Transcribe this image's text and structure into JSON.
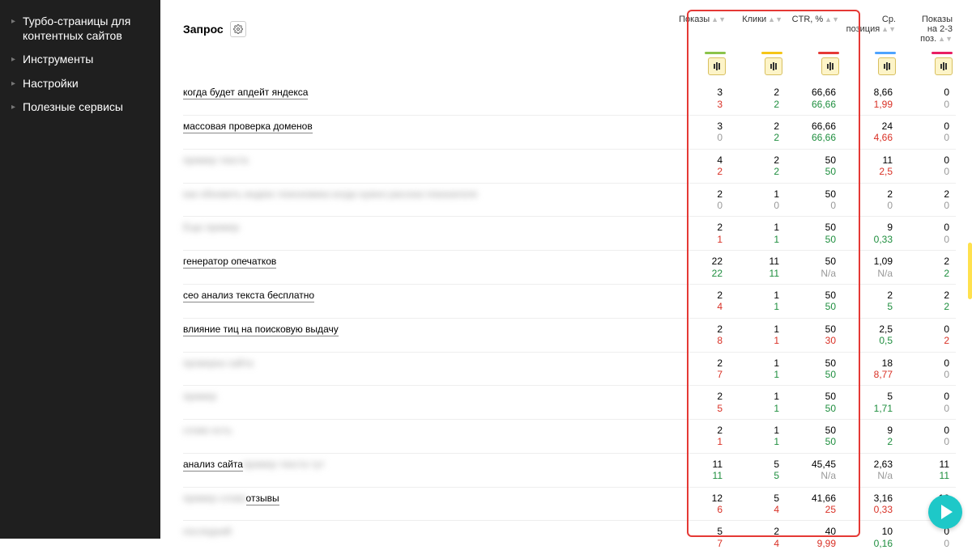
{
  "sidebar": {
    "items": [
      {
        "label": "Турбо-страницы для контентных сайтов"
      },
      {
        "label": "Инструменты"
      },
      {
        "label": "Настройки"
      },
      {
        "label": "Полезные сервисы"
      }
    ]
  },
  "header": {
    "query_label": "Запрос"
  },
  "columns": [
    {
      "label": "Показы",
      "bar": "#8bc34a"
    },
    {
      "label": "Клики",
      "bar": "#f5c518"
    },
    {
      "label": "CTR, %",
      "bar": "#e53935"
    },
    {
      "label": "Ср. позиция",
      "bar": "#4da3ff",
      "two": true,
      "l1": "Ср.",
      "l2": "позиция"
    },
    {
      "label": "Показы на 2-3 поз.",
      "bar": "#e91e63",
      "two": true,
      "l1": "Показы",
      "l2": "на 2-3",
      "l3": "поз."
    }
  ],
  "rows": [
    {
      "q": "когда будет апдейт яндекса",
      "blur": false,
      "c": [
        [
          "3",
          "3",
          "r"
        ],
        [
          "2",
          "2",
          "g"
        ],
        [
          "66,66",
          "66,66",
          "g"
        ],
        [
          "8,66",
          "1,99",
          "r"
        ],
        [
          "0",
          "0",
          "n"
        ]
      ]
    },
    {
      "q": "массовая проверка доменов",
      "blur": false,
      "c": [
        [
          "3",
          "0",
          "n"
        ],
        [
          "2",
          "2",
          "g"
        ],
        [
          "66,66",
          "66,66",
          "g"
        ],
        [
          "24",
          "4,66",
          "r"
        ],
        [
          "0",
          "0",
          "n"
        ]
      ]
    },
    {
      "q": "пример текста",
      "blur": true,
      "c": [
        [
          "4",
          "2",
          "r"
        ],
        [
          "2",
          "2",
          "g"
        ],
        [
          "50",
          "50",
          "g"
        ],
        [
          "11",
          "2,5",
          "r"
        ],
        [
          "0",
          "0",
          "n"
        ]
      ]
    },
    {
      "q": "как обновить индекс поисковика когда нужно рассказ показателя",
      "blur": true,
      "c": [
        [
          "2",
          "0",
          "n"
        ],
        [
          "1",
          "0",
          "n"
        ],
        [
          "50",
          "0",
          "n"
        ],
        [
          "2",
          "0",
          "n"
        ],
        [
          "2",
          "0",
          "n"
        ]
      ]
    },
    {
      "q": "Еще пример",
      "blur": true,
      "c": [
        [
          "2",
          "1",
          "r"
        ],
        [
          "1",
          "1",
          "g"
        ],
        [
          "50",
          "50",
          "g"
        ],
        [
          "9",
          "0,33",
          "g"
        ],
        [
          "0",
          "0",
          "n"
        ]
      ]
    },
    {
      "q": "генератор опечатков",
      "blur": false,
      "c": [
        [
          "22",
          "22",
          "g"
        ],
        [
          "11",
          "11",
          "g"
        ],
        [
          "50",
          "N/a",
          "n"
        ],
        [
          "1,09",
          "N/a",
          "n"
        ],
        [
          "2",
          "2",
          "g"
        ]
      ]
    },
    {
      "q": "сео анализ текста бесплатно",
      "blur": false,
      "c": [
        [
          "2",
          "4",
          "r"
        ],
        [
          "1",
          "1",
          "g"
        ],
        [
          "50",
          "50",
          "g"
        ],
        [
          "2",
          "5",
          "g"
        ],
        [
          "2",
          "2",
          "g"
        ]
      ]
    },
    {
      "q": "влияние тиц на поисковую выдачу",
      "blur": false,
      "c": [
        [
          "2",
          "8",
          "r"
        ],
        [
          "1",
          "1",
          "r"
        ],
        [
          "50",
          "30",
          "r"
        ],
        [
          "2,5",
          "0,5",
          "g"
        ],
        [
          "0",
          "2",
          "r"
        ]
      ]
    },
    {
      "q": "проверка сайта",
      "blur": true,
      "c": [
        [
          "2",
          "7",
          "r"
        ],
        [
          "1",
          "1",
          "g"
        ],
        [
          "50",
          "50",
          "g"
        ],
        [
          "18",
          "8,77",
          "r"
        ],
        [
          "0",
          "0",
          "n"
        ]
      ]
    },
    {
      "q": "пример",
      "blur": true,
      "c": [
        [
          "2",
          "5",
          "r"
        ],
        [
          "1",
          "1",
          "g"
        ],
        [
          "50",
          "50",
          "g"
        ],
        [
          "5",
          "1,71",
          "g"
        ],
        [
          "0",
          "0",
          "n"
        ]
      ]
    },
    {
      "q": "слово есть",
      "blur": true,
      "c": [
        [
          "2",
          "1",
          "r"
        ],
        [
          "1",
          "1",
          "g"
        ],
        [
          "50",
          "50",
          "g"
        ],
        [
          "9",
          "2",
          "g"
        ],
        [
          "0",
          "0",
          "n"
        ]
      ]
    },
    {
      "q": "анализ сайта ",
      "blur": false,
      "tail_blur": "пример текста тут",
      "c": [
        [
          "11",
          "11",
          "g"
        ],
        [
          "5",
          "5",
          "g"
        ],
        [
          "45,45",
          "N/a",
          "n"
        ],
        [
          "2,63",
          "N/a",
          "n"
        ],
        [
          "11",
          "11",
          "g"
        ]
      ]
    },
    {
      "q": " отзывы",
      "blur": false,
      "pre_blur": "пример слова",
      "c": [
        [
          "12",
          "6",
          "r"
        ],
        [
          "5",
          "4",
          "r"
        ],
        [
          "41,66",
          "25",
          "r"
        ],
        [
          "3,16",
          "0,33",
          "r"
        ],
        [
          "10",
          "5",
          "r"
        ]
      ]
    },
    {
      "q": "последний",
      "blur": true,
      "c": [
        [
          "5",
          "7",
          "r"
        ],
        [
          "2",
          "4",
          "r"
        ],
        [
          "40",
          "9,99",
          "r"
        ],
        [
          "10",
          "0,16",
          "g"
        ],
        [
          "0",
          "0",
          "n"
        ]
      ]
    }
  ]
}
